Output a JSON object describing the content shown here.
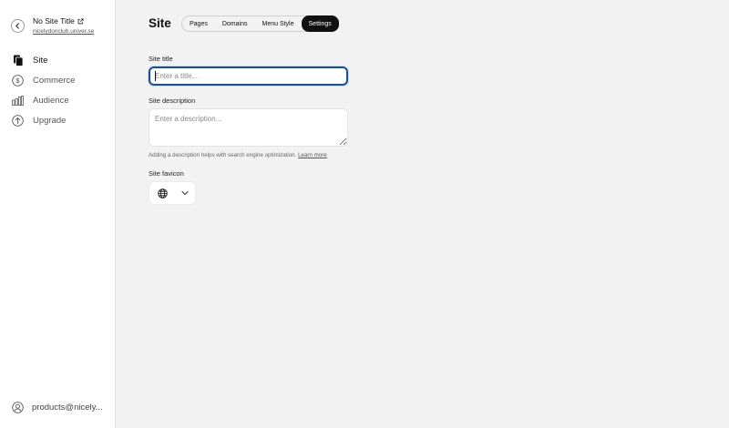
{
  "sidebar": {
    "site_name": "No Site Title",
    "site_url": "nicelydonclub.univer.se",
    "nav": [
      {
        "label": "Site",
        "icon": "pages-icon",
        "active": true
      },
      {
        "label": "Commerce",
        "icon": "dollar-icon",
        "active": false
      },
      {
        "label": "Audience",
        "icon": "bar-chart-icon",
        "active": false
      },
      {
        "label": "Upgrade",
        "icon": "arrow-up-circle-icon",
        "active": false
      }
    ],
    "account_label": "products@nicely..."
  },
  "main": {
    "title": "Site",
    "tabs": [
      {
        "label": "Pages",
        "active": false
      },
      {
        "label": "Domains",
        "active": false
      },
      {
        "label": "Menu Style",
        "active": false
      },
      {
        "label": "Settings",
        "active": true
      }
    ],
    "site_title_label": "Site title",
    "site_title_placeholder": "Enter a title...",
    "site_title_value": "",
    "site_description_label": "Site description",
    "site_description_placeholder": "Enter a description...",
    "site_description_value": "",
    "help_text": "Adding a description helps with search engine optimization.",
    "learn_more": "Learn more",
    "favicon_label": "Site favicon",
    "favicon_icon": "globe-icon"
  },
  "colors": {
    "accent": "#1f4e8c",
    "active_tab_bg": "#111111",
    "background": "#f2f2f2"
  }
}
